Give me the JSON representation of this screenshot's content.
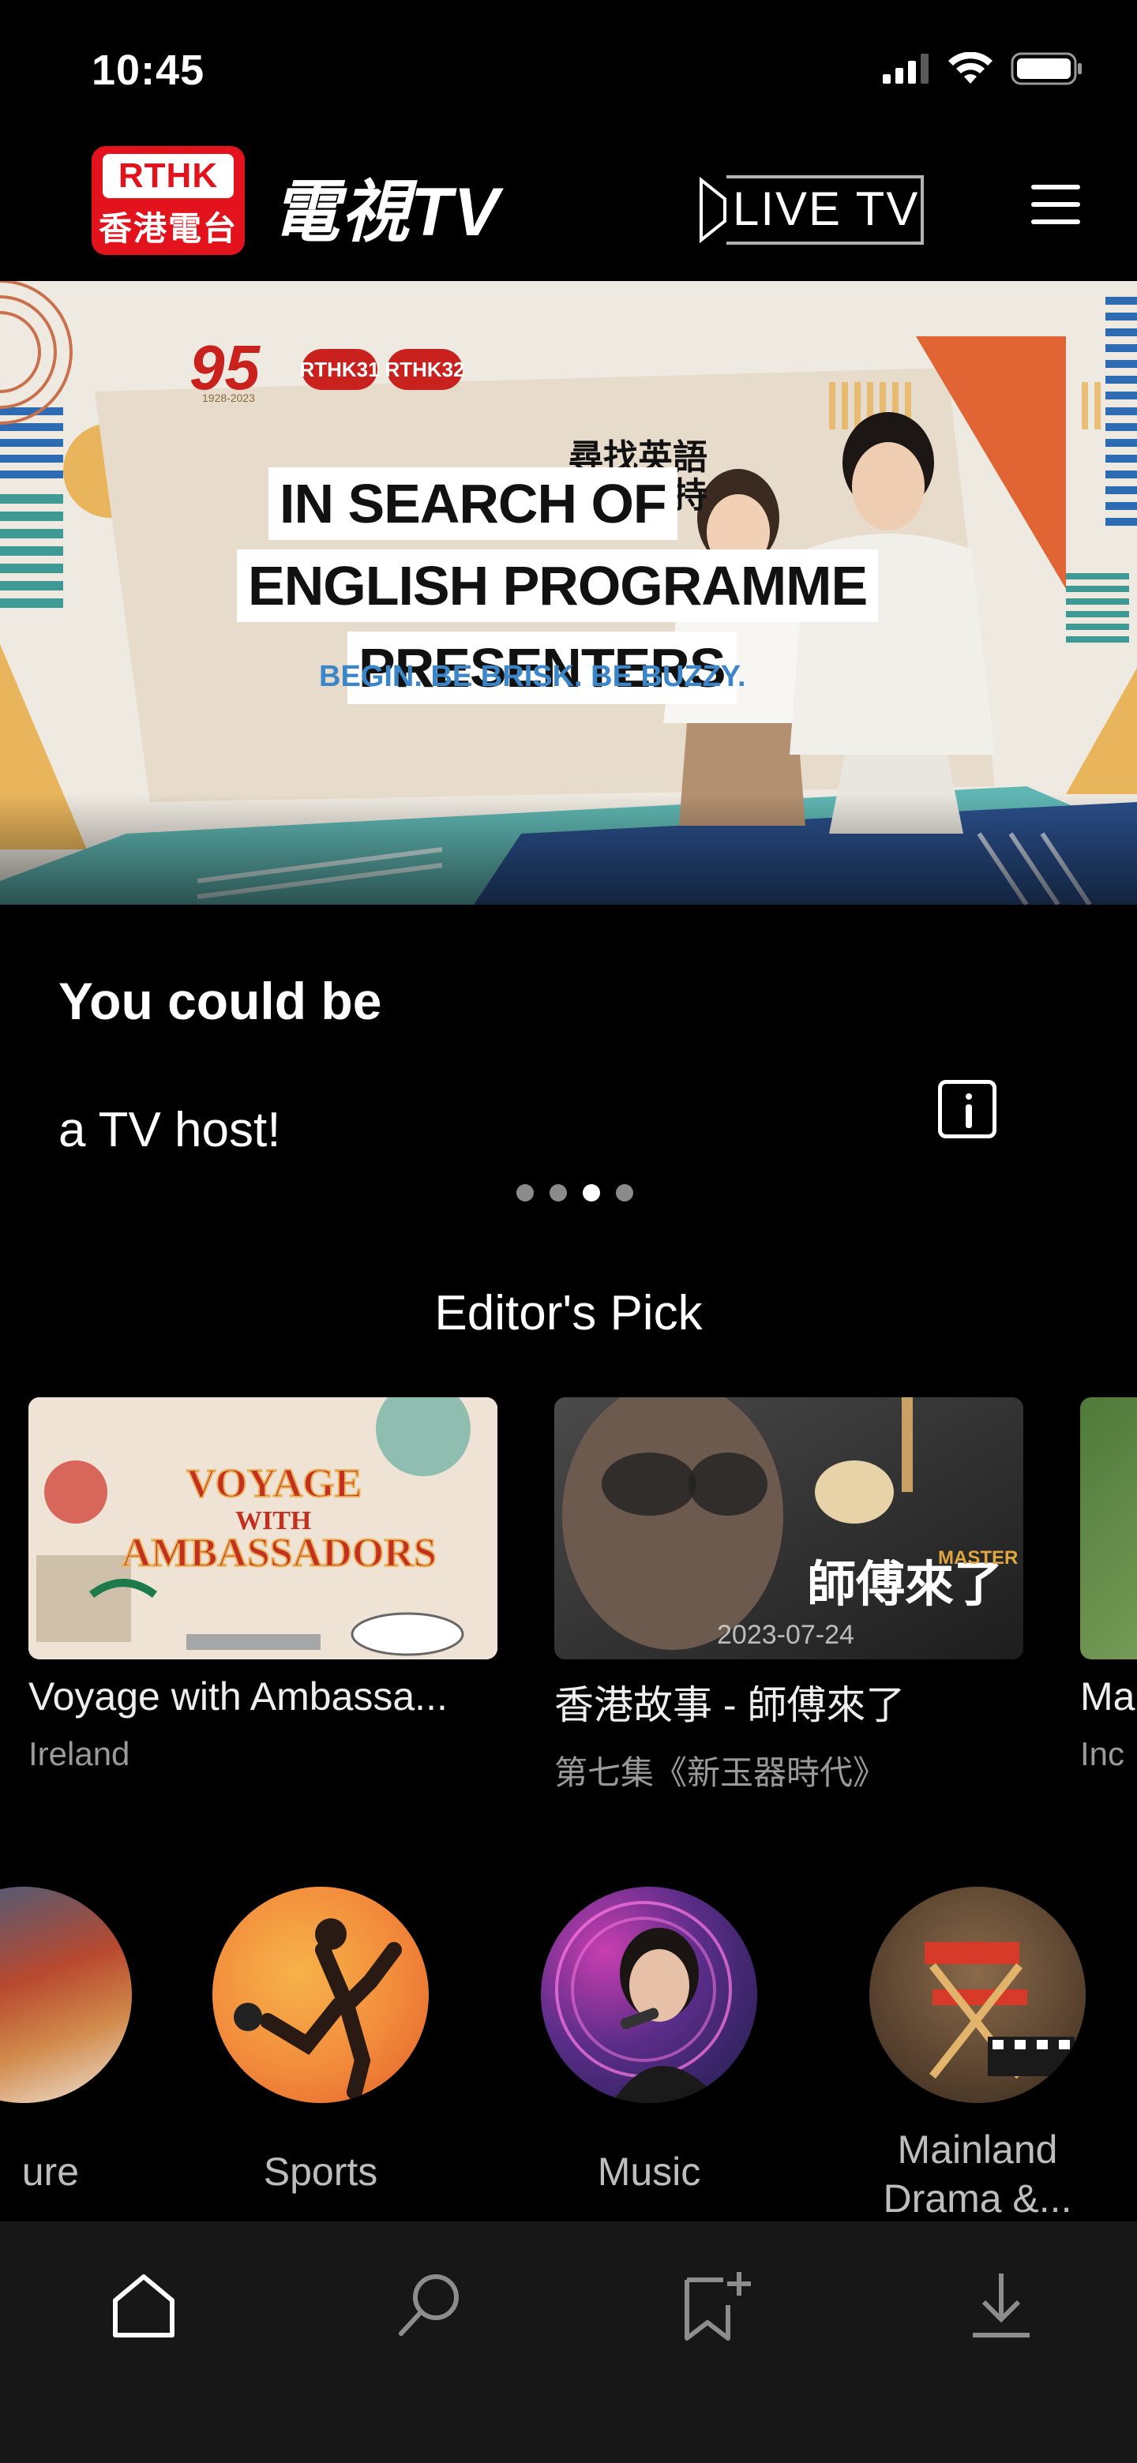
{
  "status_bar": {
    "time": "10:45"
  },
  "header": {
    "logo_top": "RTHK",
    "logo_bottom": "香港電台",
    "app_title": "電視TV",
    "live_button_label": "LIVE TV"
  },
  "banner": {
    "badge_number": "95",
    "badge_years": "1928-2023",
    "channel_1": "RTHK31",
    "channel_2": "RTHK32",
    "headline_line_1": "IN SEARCH OF",
    "headline_line_2": "ENGLISH PROGRAMME",
    "headline_line_3": "PRESENTERS",
    "tagline": "BEGIN. BE BRISK. BE BUZZY.",
    "chinese_tag_line_1": "尋找英語",
    "chinese_tag_line_2": "電視主持"
  },
  "caption": {
    "title": "You could be",
    "subtitle": "a TV host!",
    "carousel_total": 4,
    "carousel_active_index": 2
  },
  "editors_pick": {
    "title": "Editor's Pick",
    "cards": [
      {
        "title": "Voyage with Ambassa...",
        "subtitle": "Ireland",
        "thumb_text_1": "VOYAGE",
        "thumb_text_2": "WITH",
        "thumb_text_3": "AMBASSADORS"
      },
      {
        "title": "香港故事 - 師傅來了",
        "subtitle": "第七集《新玉器時代》",
        "thumb_date": "2023-07-24",
        "thumb_text_1": "師傅來了",
        "thumb_text_2": "MASTER"
      },
      {
        "title": "Ma",
        "subtitle": "Inc"
      }
    ]
  },
  "categories": [
    {
      "label": "ure"
    },
    {
      "label": "Sports"
    },
    {
      "label": "Music"
    },
    {
      "label": "Mainland Drama &..."
    }
  ],
  "tabbar": {
    "tabs": [
      {
        "icon": "home-icon",
        "active": true
      },
      {
        "icon": "search-icon",
        "active": false
      },
      {
        "icon": "bookmark-add-icon",
        "active": false
      },
      {
        "icon": "download-icon",
        "active": false
      }
    ]
  },
  "colors": {
    "brand_red": "#e2131c",
    "background": "#000000",
    "tabbar": "#171717",
    "muted_text": "#9a9a9a"
  }
}
